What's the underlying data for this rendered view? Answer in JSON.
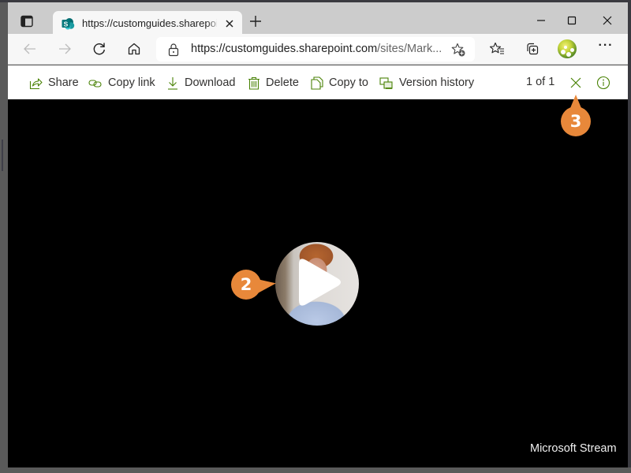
{
  "browser": {
    "tab": {
      "title": "https://customguides.sharepoint.com/sites/Marketing",
      "favicon": "sharepoint-icon"
    },
    "window_controls": {
      "minimize": "minimize-icon",
      "maximize": "maximize-icon",
      "close": "close-icon"
    },
    "address_bar": {
      "url_host": "https://customguides.sharepoint.com",
      "url_path": "/sites/Mark..."
    },
    "icons": {
      "back": "arrow-left-icon",
      "forward": "arrow-right-icon",
      "refresh": "refresh-icon",
      "home": "home-icon",
      "lock": "lock-icon",
      "add_favorite": "star-add-icon",
      "favorites": "favorites-icon",
      "collections": "collections-icon",
      "profile": "profile-avatar",
      "more": "more-icon"
    },
    "more_label": "···"
  },
  "command_bar": {
    "share": "Share",
    "copy_link": "Copy link",
    "download": "Download",
    "delete": "Delete",
    "copy_to": "Copy to",
    "version_history": "Version history",
    "pager": "1 of 1",
    "accent_color": "#498205"
  },
  "viewer": {
    "brand": "Microsoft Stream",
    "play_icon": "play-icon"
  },
  "callouts": {
    "step_2": "2",
    "step_3": "3",
    "color": "#e8883a"
  }
}
